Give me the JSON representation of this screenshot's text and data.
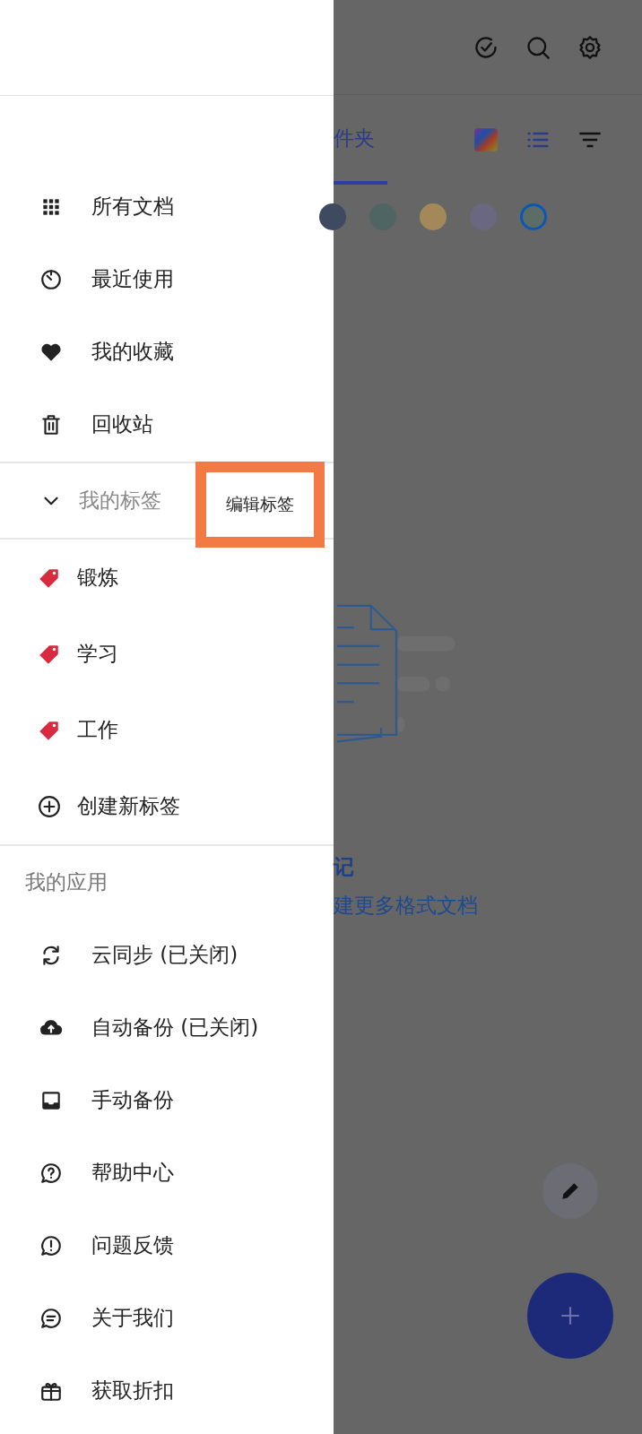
{
  "drawer": {
    "nav_items": [
      {
        "label": "所有文档"
      },
      {
        "label": "最近使用"
      },
      {
        "label": "我的收藏"
      },
      {
        "label": "回收站"
      }
    ],
    "tags_section": {
      "title": "我的标签",
      "expanded": true,
      "edit_button": {
        "label": "编辑标签",
        "highlighted": true
      }
    },
    "tags": [
      {
        "label": "锻炼",
        "color": "#d92b3f"
      },
      {
        "label": "学习",
        "color": "#d92b3f"
      },
      {
        "label": "工作",
        "color": "#d92b3f"
      }
    ],
    "create_tag": {
      "label": "创建新标签"
    },
    "apps_section": {
      "title": "我的应用"
    },
    "app_items": [
      {
        "label": "云同步 (已关闭)"
      },
      {
        "label": "自动备份 (已关闭)"
      },
      {
        "label": "手动备份"
      },
      {
        "label": "帮助中心"
      },
      {
        "label": "问题反馈"
      },
      {
        "label": "关于我们"
      },
      {
        "label": "获取折扣"
      }
    ]
  },
  "background": {
    "tabs": [
      {
        "label": "件夹",
        "selected": true
      }
    ],
    "color_filters": [
      {
        "color": "#3e4a60",
        "selected": false
      },
      {
        "color": "#4e6563",
        "selected": false
      },
      {
        "color": "#a3895a",
        "selected": false
      },
      {
        "color": "#6a6780",
        "selected": false
      },
      {
        "color": "#5c6d66",
        "selected": true
      }
    ],
    "empty_state": {
      "title": "记",
      "subtitle": "建更多格式文档"
    }
  }
}
